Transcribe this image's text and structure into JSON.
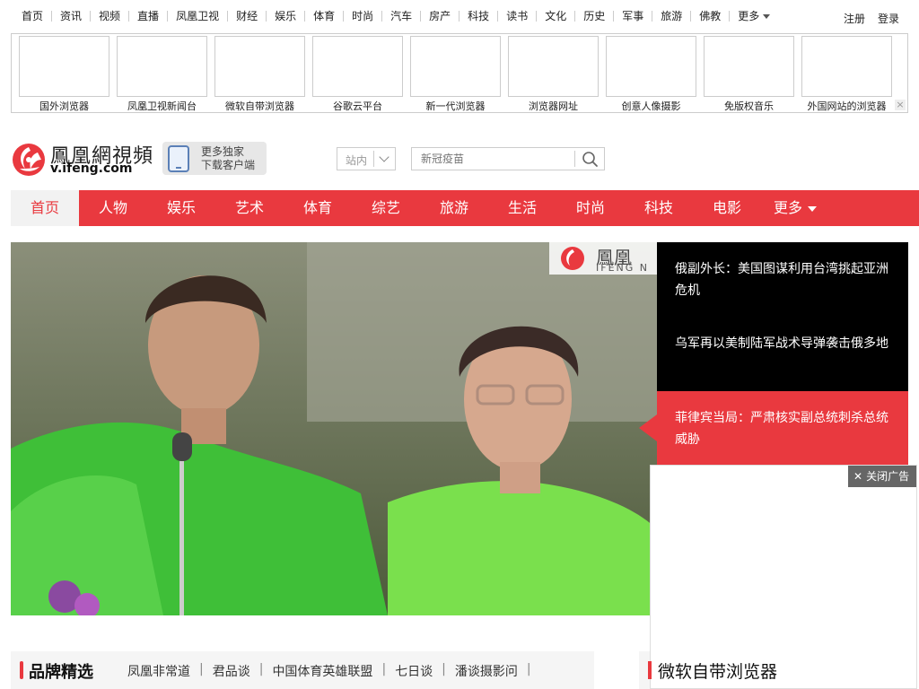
{
  "topnav": {
    "links": [
      "首页",
      "资讯",
      "视频",
      "直播",
      "凤凰卫视",
      "财经",
      "娱乐",
      "体育",
      "时尚",
      "汽车",
      "房产",
      "科技",
      "读书",
      "文化",
      "历史",
      "军事",
      "旅游",
      "佛教"
    ],
    "more_label": "更多",
    "register": "注册",
    "login": "登录"
  },
  "adstrip": {
    "tiles": [
      "国外浏览器",
      "凤凰卫视新闻台",
      "微软自带浏览器",
      "谷歌云平台",
      "新一代浏览器",
      "浏览器网址",
      "创意人像摄影",
      "免版权音乐",
      "外国网站的浏览器"
    ],
    "close_glyph": "×"
  },
  "header": {
    "logo_cn": "鳳凰網視頻",
    "logo_url": "v.ifeng.com",
    "app_line1": "更多独家",
    "app_line2": "下载客户端",
    "search_scope": "站内",
    "search_placeholder": "新冠疫苗"
  },
  "channels": {
    "items": [
      "首页",
      "人物",
      "娱乐",
      "艺术",
      "体育",
      "综艺",
      "旅游",
      "生活",
      "时尚",
      "科技",
      "电影"
    ],
    "more_label": "更多",
    "active_index": 0
  },
  "hero": {
    "watermark_cn": "鳳凰",
    "watermark_en": "IFENG N"
  },
  "headlines": [
    "俄副外长：美国图谋利用台湾挑起亚洲危机",
    "乌军再以美制陆军战术导弹袭击俄多地",
    "菲律宾当局：严肃核实副总统刺杀总统威胁"
  ],
  "overlay_ad": {
    "close_label": "关闭广告",
    "close_glyph": "✕",
    "title": "微软自带浏览器"
  },
  "brand": {
    "title": "品牌精选",
    "links": [
      "凤凰非常道",
      "君品谈",
      "中国体育英雄联盟",
      "七日谈",
      "潘谈摄影问"
    ]
  },
  "colors": {
    "accent": "#e9393f",
    "headline_bg": "#000000"
  }
}
